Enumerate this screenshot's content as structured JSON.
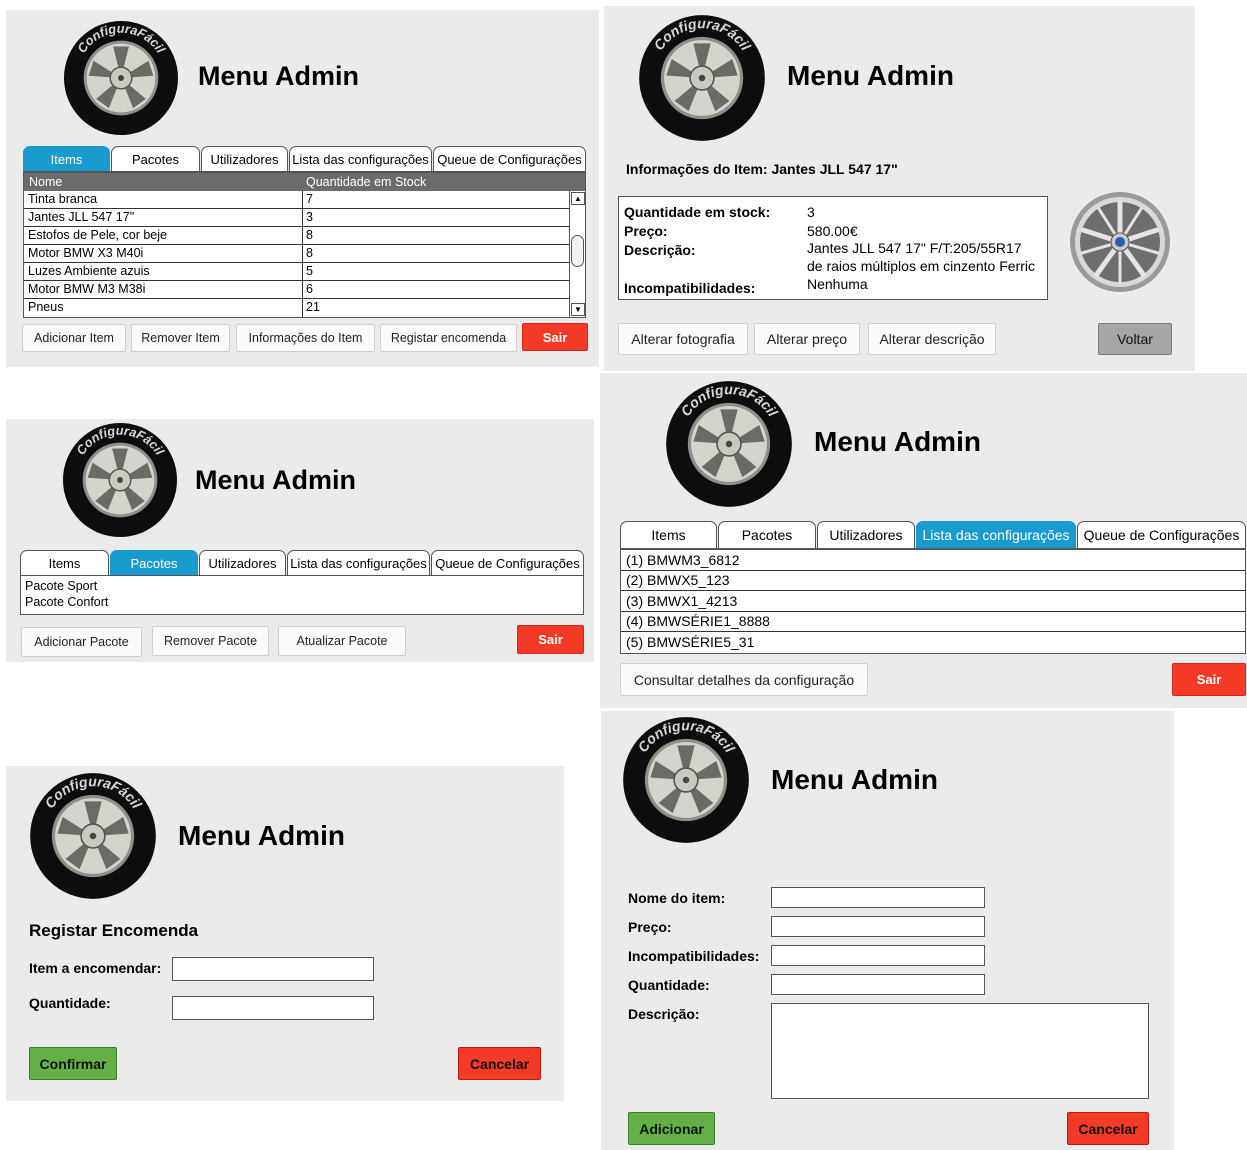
{
  "brand": "ConfiguraFácil",
  "title": "Menu Admin",
  "tabs": [
    "Items",
    "Pacotes",
    "Utilizadores",
    "Lista das configurações",
    "Queue de Configurações"
  ],
  "items_screen": {
    "headers": [
      "Nome",
      "Quantidade em Stock"
    ],
    "rows": [
      {
        "name": "Tinta branca",
        "qty": "7"
      },
      {
        "name": "Jantes JLL 547 17\"",
        "qty": "3"
      },
      {
        "name": "Estofos de Pele, cor beje",
        "qty": "8"
      },
      {
        "name": "Motor BMW X3 M40i",
        "qty": "8"
      },
      {
        "name": "Luzes Ambiente azuis",
        "qty": "5"
      },
      {
        "name": "Motor BMW M3 M38i",
        "qty": "6"
      },
      {
        "name": "Pneus",
        "qty": "21"
      }
    ],
    "buttons": {
      "add": "Adicionar Item",
      "remove": "Remover Item",
      "info": "Informações do Item",
      "order": "Registar encomenda",
      "exit": "Sair"
    }
  },
  "item_info_screen": {
    "heading": "Informações do Item: Jantes JLL 547 17\"",
    "labels": {
      "stock": "Quantidade em stock:",
      "price": "Preço:",
      "description": "Descrição:",
      "incompat": "Incompatibilidades:"
    },
    "values": {
      "stock": "3",
      "price": "580.00€",
      "description_1": "Jantes JLL 547 17\" F/T:205/55R17",
      "description_2": "de raios múltiplos em cinzento Ferric",
      "incompat": "Nenhuma"
    },
    "buttons": {
      "photo": "Alterar fotografia",
      "price": "Alterar preço",
      "description": "Alterar descrição",
      "back": "Voltar"
    }
  },
  "packages_screen": {
    "items": [
      "Pacote Sport",
      "Pacote Confort"
    ],
    "buttons": {
      "add": "Adicionar Pacote",
      "remove": "Remover Pacote",
      "update": "Atualizar Pacote",
      "exit": "Sair"
    }
  },
  "configs_screen": {
    "items": [
      "(1) BMWM3_6812",
      "(2) BMWX5_123",
      "(3) BMWX1_4213",
      "(4) BMWSÉRIE1_8888",
      "(5) BMWSÉRIE5_31"
    ],
    "buttons": {
      "details": "Consultar detalhes da configuração",
      "exit": "Sair"
    }
  },
  "order_screen": {
    "heading": "Registar Encomenda",
    "labels": {
      "item": "Item a encomendar:",
      "qty": "Quantidade:"
    },
    "buttons": {
      "confirm": "Confirmar",
      "cancel": "Cancelar"
    }
  },
  "add_item_screen": {
    "labels": {
      "name": "Nome do item:",
      "price": "Preço:",
      "incompat": "Incompatibilidades:",
      "qty": "Quantidade:",
      "description": "Descrição:"
    },
    "buttons": {
      "add": "Adicionar",
      "cancel": "Cancelar"
    }
  },
  "colors": {
    "active_tab": "#1a9bd0",
    "exit": "#f23a26",
    "confirm": "#62b046",
    "panel": "#ebebeb"
  }
}
